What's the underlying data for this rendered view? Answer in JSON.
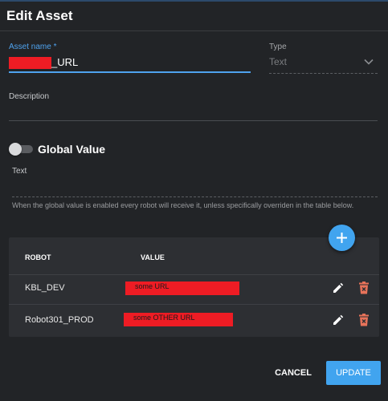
{
  "dialog": {
    "title": "Edit Asset"
  },
  "form": {
    "name_label": "Asset name *",
    "name_value": "_URL",
    "type_label": "Type",
    "type_value": "Text",
    "description_label": "Description",
    "global_toggle_on": false,
    "global_label": "Global Value",
    "text_label": "Text",
    "hint": "When the global value is enabled every robot will receive it, unless specifically overriden in the table below."
  },
  "table": {
    "headers": [
      "ROBOT",
      "VALUE"
    ],
    "rows": [
      {
        "robot": "KBL_DEV",
        "value": "some URL"
      },
      {
        "robot": "Robot301_PROD",
        "value": "some OTHER URL"
      }
    ]
  },
  "actions": {
    "cancel": "CANCEL",
    "update": "UPDATE"
  },
  "colors": {
    "accent": "#41a4ef",
    "redaction": "#ee1c24",
    "delete": "#e8735a"
  },
  "icons": {
    "add": "plus-icon",
    "edit": "pencil-icon",
    "delete": "trash-icon",
    "dropdown": "chevron-down-icon"
  }
}
